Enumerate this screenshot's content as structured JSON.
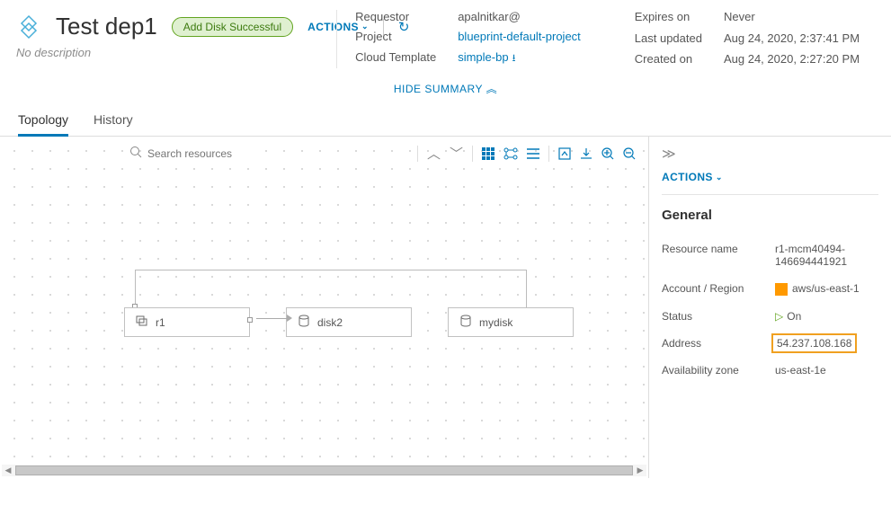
{
  "header": {
    "title": "Test dep1",
    "badge": "Add Disk Successful",
    "actions_label": "ACTIONS",
    "description": "No description"
  },
  "summary": {
    "requestor_label": "Requestor",
    "requestor_value": "apalnitkar@",
    "project_label": "Project",
    "project_value": "blueprint-default-project",
    "template_label": "Cloud Template",
    "template_value": "simple-bp",
    "expires_label": "Expires on",
    "expires_value": "Never",
    "updated_label": "Last updated",
    "updated_value": "Aug 24, 2020, 2:37:41 PM",
    "created_label": "Created on",
    "created_value": "Aug 24, 2020, 2:27:20 PM",
    "hide_label": "HIDE SUMMARY"
  },
  "tabs": {
    "topology": "Topology",
    "history": "History"
  },
  "search": {
    "placeholder": "Search resources"
  },
  "nodes": {
    "r1": "r1",
    "disk2": "disk2",
    "mydisk": "mydisk"
  },
  "sidebar": {
    "actions_label": "ACTIONS",
    "section_title": "General",
    "resource_name_label": "Resource name",
    "resource_name_value": "r1-mcm40494-146694441921",
    "account_label": "Account / Region",
    "account_value": "aws/us-east-1",
    "status_label": "Status",
    "status_value": "On",
    "address_label": "Address",
    "address_value": "54.237.108.168",
    "az_label": "Availability zone",
    "az_value": "us-east-1e"
  }
}
